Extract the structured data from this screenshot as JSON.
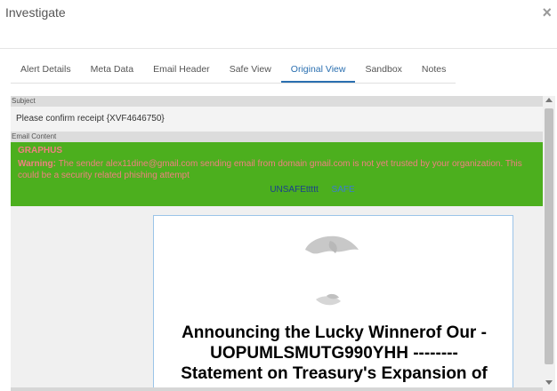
{
  "modal": {
    "title": "Investigate",
    "close_icon": "×"
  },
  "tabs": [
    {
      "label": "Alert Details",
      "active": false
    },
    {
      "label": "Meta Data",
      "active": false
    },
    {
      "label": "Email Header",
      "active": false
    },
    {
      "label": "Safe View",
      "active": false
    },
    {
      "label": "Original View",
      "active": true
    },
    {
      "label": "Sandbox",
      "active": false
    },
    {
      "label": "Notes",
      "active": false
    }
  ],
  "subject": {
    "label": "Subject",
    "value": "Please confirm receipt {XVF4646750}"
  },
  "email_content": {
    "label": "Email Content",
    "banner": {
      "title": "GRAPHUS",
      "warning_prefix": "Warning:",
      "warning_text": " The sender alex11dine@gmail.com sending email from domain gmail.com is not yet trusted by your organization. This could be a security related phishing attempt",
      "unsafe_label": "UNSAFEttttt",
      "safe_label": "SAFE"
    },
    "body": {
      "headline_lines": [
        "Announcing the Lucky Winnerof Our -",
        "UOPUMLSMUTG990YHH --------",
        "Statement on Treasury's Expansion of"
      ],
      "image_icon": "globe-icon"
    }
  },
  "colors": {
    "active_tab": "#2a6fb0",
    "banner_bg": "#4caf1e",
    "banner_text": "#f08080",
    "unsafe_link": "#1b3e8f",
    "safe_link": "#3c7ad6"
  }
}
